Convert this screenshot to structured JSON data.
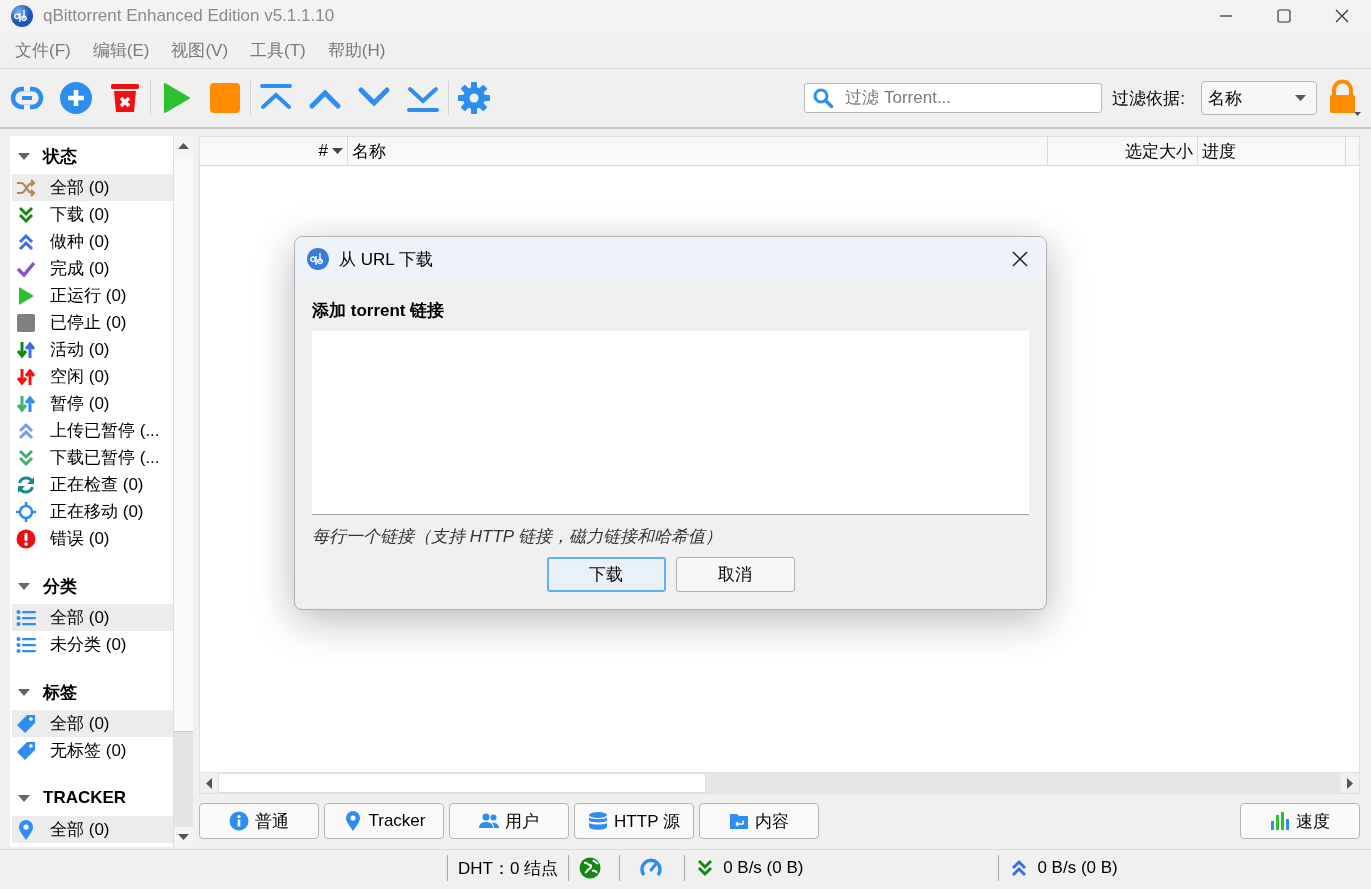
{
  "window": {
    "title": "qBittorrent Enhanced Edition v5.1.1.10"
  },
  "menu": [
    "文件(F)",
    "编辑(E)",
    "视图(V)",
    "工具(T)",
    "帮助(H)"
  ],
  "toolbar_groups": [
    [
      {
        "kind": "link"
      },
      {
        "kind": "add"
      },
      {
        "kind": "delete"
      }
    ],
    [
      {
        "kind": "start"
      },
      {
        "kind": "stop"
      }
    ],
    [
      {
        "kind": "top"
      },
      {
        "kind": "up"
      },
      {
        "kind": "down"
      },
      {
        "kind": "bottom"
      }
    ],
    [
      {
        "kind": "settings"
      }
    ]
  ],
  "filter": {
    "placeholder": "过滤 Torrent...",
    "by_label": "过滤依据:",
    "by_value": "名称"
  },
  "sidebar": {
    "sections": [
      {
        "title": "状态",
        "expanded": true,
        "items": [
          {
            "label": "全部 (0)",
            "kind": "all",
            "selected": true
          },
          {
            "label": "下载 (0)",
            "kind": "downloading",
            "selected": false
          },
          {
            "label": "做种 (0)",
            "kind": "seeding",
            "selected": false
          },
          {
            "label": "完成 (0)",
            "kind": "completed",
            "selected": false
          },
          {
            "label": "正运行 (0)",
            "kind": "running",
            "selected": false
          },
          {
            "label": "已停止 (0)",
            "kind": "stopped",
            "selected": false
          },
          {
            "label": "活动 (0)",
            "kind": "active",
            "selected": false
          },
          {
            "label": "空闲 (0)",
            "kind": "inactive",
            "selected": false
          },
          {
            "label": "暂停 (0)",
            "kind": "stalled",
            "selected": false
          },
          {
            "label": "上传已暂停 (...",
            "kind": "stalled_up",
            "selected": false
          },
          {
            "label": "下载已暂停 (...",
            "kind": "stalled_down",
            "selected": false
          },
          {
            "label": "正在检查 (0)",
            "kind": "checking",
            "selected": false
          },
          {
            "label": "正在移动 (0)",
            "kind": "moving",
            "selected": false
          },
          {
            "label": "错误 (0)",
            "kind": "errored",
            "selected": false
          }
        ]
      },
      {
        "title": "分类",
        "expanded": true,
        "items": [
          {
            "label": "全部 (0)",
            "kind": "category",
            "selected": true
          },
          {
            "label": "未分类 (0)",
            "kind": "category",
            "selected": false
          }
        ]
      },
      {
        "title": "标签",
        "expanded": true,
        "items": [
          {
            "label": "全部 (0)",
            "kind": "tag",
            "selected": true
          },
          {
            "label": "无标签 (0)",
            "kind": "tag",
            "selected": false
          }
        ]
      },
      {
        "title": "TRACKER",
        "expanded": true,
        "items": [
          {
            "label": "全部 (0)",
            "kind": "tracker",
            "selected": true
          }
        ]
      }
    ]
  },
  "list": {
    "columns": [
      {
        "label": "#",
        "sorted": true
      },
      {
        "label": "名称",
        "sorted": false
      },
      {
        "label": "选定大小",
        "sorted": false
      },
      {
        "label": "进度",
        "sorted": false
      }
    ]
  },
  "detail_tabs": [
    {
      "label": "普通",
      "kind": "info"
    },
    {
      "label": "Tracker",
      "kind": "tracker"
    },
    {
      "label": "用户",
      "kind": "users"
    },
    {
      "label": "HTTP 源",
      "kind": "database"
    },
    {
      "label": "内容",
      "kind": "folder"
    }
  ],
  "speed_button": {
    "label": "速度"
  },
  "status_bar": {
    "dht": "DHT：0 结点",
    "download": "0 B/s (0 B)",
    "upload": "0 B/s (0 B)"
  },
  "dialog": {
    "title": "从 URL 下载",
    "label": "添加 torrent 链接",
    "hint": "每行一个链接（支持 HTTP 链接，磁力链接和哈希值）",
    "buttons": [
      {
        "label": "下载",
        "default": true
      },
      {
        "label": "取消",
        "default": false
      }
    ]
  }
}
